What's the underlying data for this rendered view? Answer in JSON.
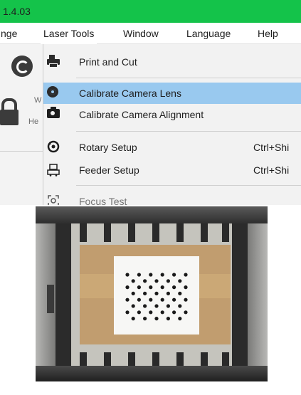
{
  "titlebar": {
    "text": "1.4.03",
    "color": "#14c34a"
  },
  "menubar": {
    "items": [
      {
        "label": "nge"
      },
      {
        "label": "Laser Tools"
      },
      {
        "label": "Window"
      },
      {
        "label": "Language"
      },
      {
        "label": "Help"
      }
    ]
  },
  "background_app": {
    "text_w": "W",
    "text_he": "He"
  },
  "dropdown": {
    "highlight_color": "#99c9ef",
    "items": [
      {
        "label": "Print and Cut",
        "icon": "printer-icon",
        "shortcut": ""
      },
      {
        "label": "Calibrate Camera Lens",
        "icon": "lens-icon",
        "shortcut": ""
      },
      {
        "label": "Calibrate Camera Alignment",
        "icon": "camera-icon",
        "shortcut": ""
      },
      {
        "label": "Rotary Setup",
        "icon": "rotary-icon",
        "shortcut": "Ctrl+Shi"
      },
      {
        "label": "Feeder Setup",
        "icon": "feeder-icon",
        "shortcut": "Ctrl+Shi"
      },
      {
        "label": "Focus Test",
        "icon": "focus-icon",
        "shortcut": ""
      }
    ]
  },
  "photo": {
    "subject": "calibration-grid-photo"
  }
}
